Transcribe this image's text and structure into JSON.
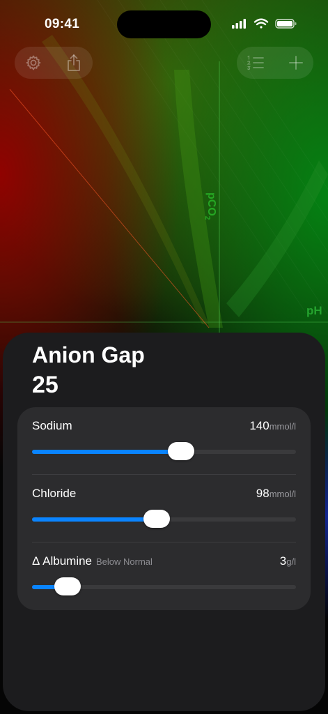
{
  "status_bar": {
    "time": "09:41",
    "icons": [
      "cellular-signal-icon",
      "wifi-icon",
      "battery-icon"
    ]
  },
  "toolbar_left": {
    "buttons": [
      {
        "name": "settings",
        "icon": "gear-icon"
      },
      {
        "name": "share",
        "icon": "share-icon"
      }
    ]
  },
  "toolbar_right": {
    "buttons": [
      {
        "name": "list",
        "icon": "numbered-list-icon"
      },
      {
        "name": "add",
        "icon": "plus-icon"
      }
    ]
  },
  "plot": {
    "y_label": "pCO",
    "y_label_subscript": "2",
    "x_label": "pH"
  },
  "sheet": {
    "title": "Anion Gap",
    "value": "25",
    "sliders": [
      {
        "label": "Sodium",
        "sublabel": "",
        "value": "140",
        "unit": "mmol/l",
        "fraction": 0.565
      },
      {
        "label": "Chloride",
        "sublabel": "",
        "value": "98",
        "unit": "mmol/l",
        "fraction": 0.473
      },
      {
        "label": "Δ Albumine",
        "sublabel": "Below Normal",
        "value": "3",
        "unit": "g/l",
        "fraction": 0.135
      }
    ]
  },
  "colors": {
    "accent": "#0a84ff",
    "sheet_bg": "#1c1c1e",
    "card_bg": "#2c2c2e",
    "plot_green": "#28b428"
  }
}
